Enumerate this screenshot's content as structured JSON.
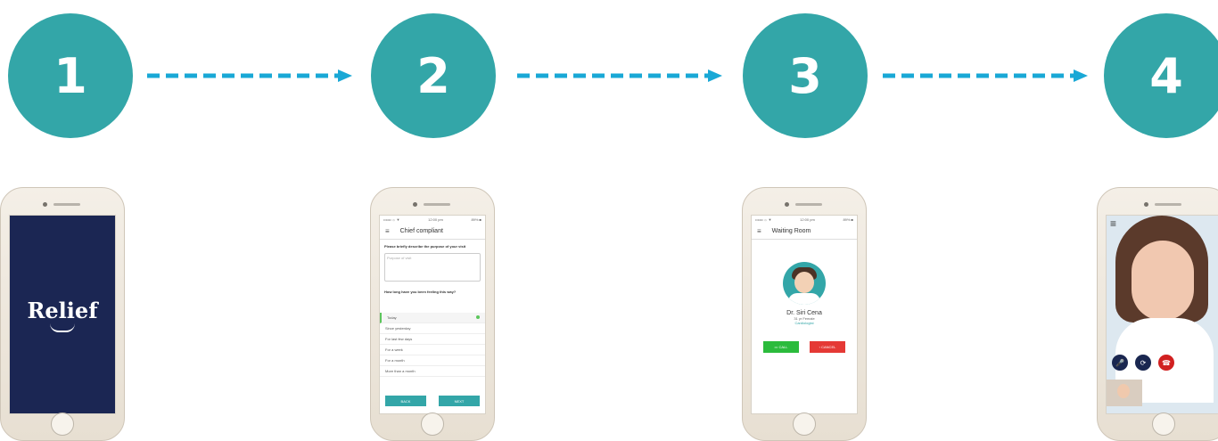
{
  "steps": [
    "1",
    "2",
    "3",
    "4"
  ],
  "screens": {
    "s1": {
      "logo": "Relief"
    },
    "s2": {
      "status_left": "•••oo ☼ ▼",
      "status_time": "12:00 pm",
      "status_right": "89% ■",
      "title": "Chief compliant",
      "question1": "Please briefly describe the purpose of your visit",
      "placeholder": "Purpose of visit",
      "question2": "How long have you been feeling this way?",
      "options": [
        "Today",
        "Since yesterday",
        "For last few days",
        "For a week",
        "For a month",
        "More than a month"
      ],
      "back": "BACK",
      "next": "NEXT"
    },
    "s3": {
      "status_left": "•••oo ☼ ▼",
      "status_time": "12:00 pm",
      "status_right": "89% ■",
      "title": "Waiting Room",
      "doctor": "Dr. Siri Cena",
      "doctor_meta": "31 yr Female",
      "specialty": "Cardiologist",
      "call": "CALL",
      "cancel": "CANCEL"
    },
    "s4": {
      "menu": "≡"
    }
  },
  "colors": {
    "teal": "#33a6a8",
    "arrow": "#19a8d6",
    "dark": "#1b2653"
  }
}
